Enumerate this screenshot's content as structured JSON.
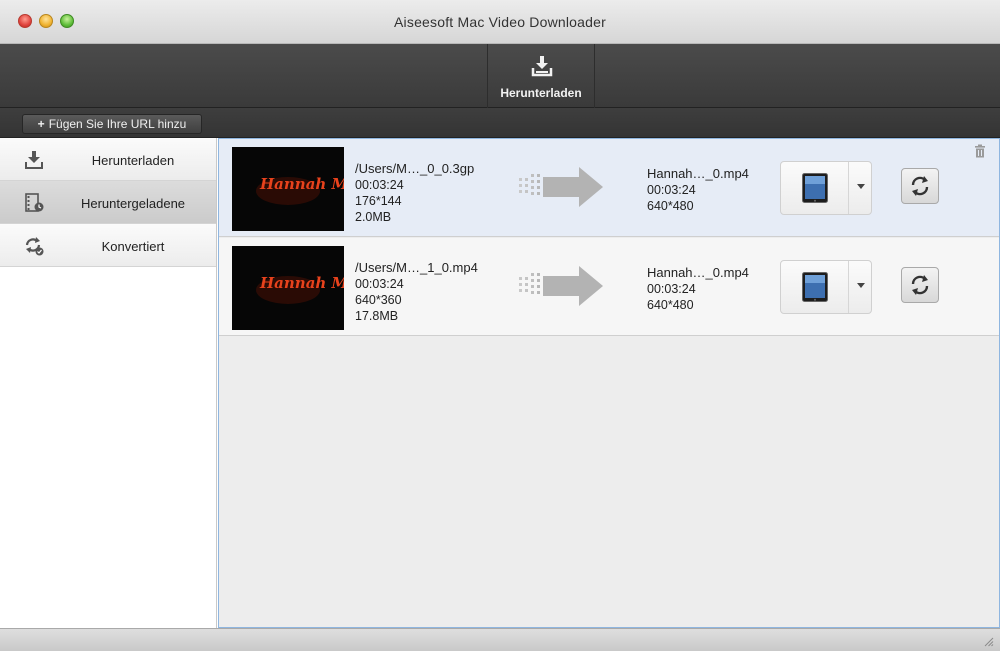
{
  "window": {
    "title": "Aiseesoft Mac Video Downloader"
  },
  "toolbar": {
    "download_label": "Herunterladen",
    "download_icon": "download-tray-icon"
  },
  "url_bar": {
    "add_url_label": "Fügen Sie Ihre URL hinzu",
    "add_icon": "plus-icon"
  },
  "sidebar": {
    "items": [
      {
        "label": "Herunterladen",
        "icon": "download-icon",
        "active": false
      },
      {
        "label": "Heruntergeladene",
        "icon": "film-strip-icon",
        "active": true
      },
      {
        "label": "Konvertiert",
        "icon": "convert-icon",
        "active": false
      }
    ]
  },
  "rows": [
    {
      "thumbnail_text": "Hannah Montana",
      "source": {
        "path": "/Users/M…_0_0.3gp",
        "duration": "00:03:24",
        "resolution": "176*144",
        "size": "2.0MB"
      },
      "output": {
        "name": "Hannah…_0.mp4",
        "duration": "00:03:24",
        "resolution": "640*480"
      },
      "device_icon": "ipad-icon"
    },
    {
      "thumbnail_text": "Hannah Montana",
      "source": {
        "path": "/Users/M…_1_0.mp4",
        "duration": "00:03:24",
        "resolution": "640*360",
        "size": "17.8MB"
      },
      "output": {
        "name": "Hannah…_0.mp4",
        "duration": "00:03:24",
        "resolution": "640*480"
      },
      "device_icon": "ipad-icon"
    }
  ],
  "colors": {
    "toolbar": "#3f3f3f",
    "selection_border": "#8fb6e0",
    "row_selected": "#e6ecf6",
    "thumb_title": "#e8421c"
  }
}
